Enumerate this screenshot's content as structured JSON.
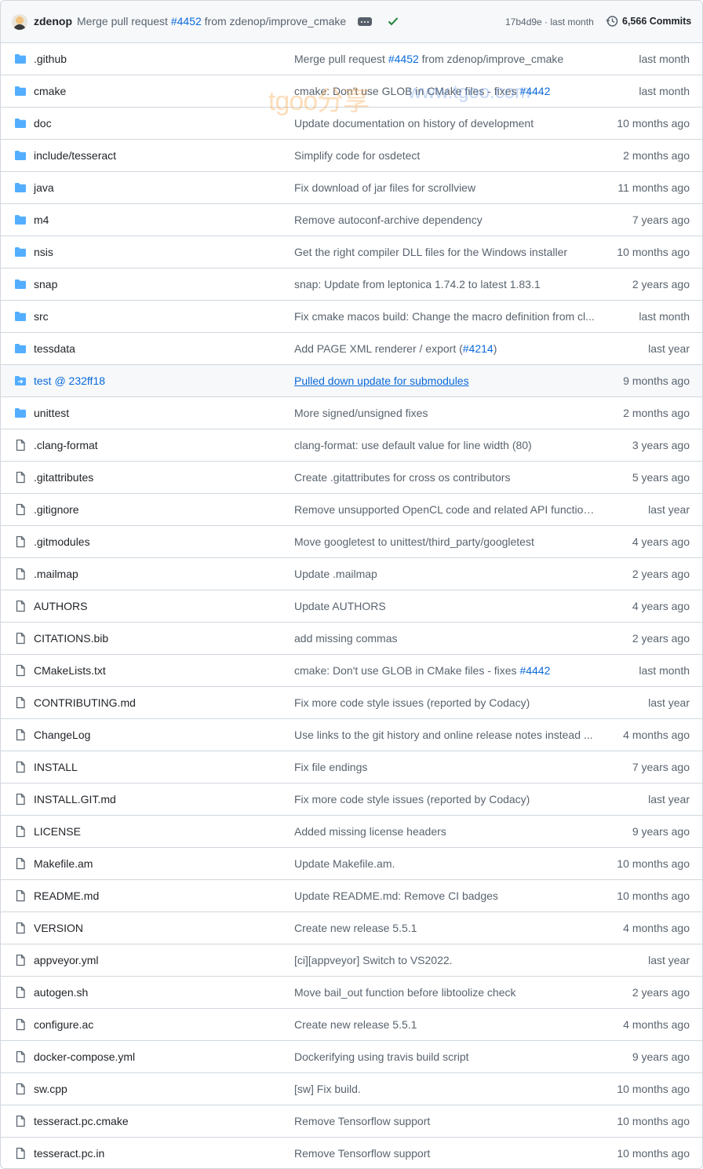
{
  "latest_commit": {
    "author": "zdenop",
    "message_prefix": "Merge pull request ",
    "pr_link": "#4452",
    "message_suffix": " from zdenop/improve_cmake",
    "sha": "17b4d9e · last month",
    "commits_count": "6,566 Commits",
    "status_color": "#1a7f37"
  },
  "watermark": {
    "text_a": "tgoo分享",
    "text_b": "www.tgoo.com"
  },
  "colors": {
    "folder": "#54aeff",
    "file_icon": "#59636e",
    "link": "#0969da"
  },
  "rows": [
    {
      "type": "folder",
      "name": ".github",
      "msg_before": "Merge pull request ",
      "msg_link": "#4452",
      "msg_after": " from zdenop/improve_cmake",
      "age": "last month"
    },
    {
      "type": "folder",
      "name": "cmake",
      "msg_before": "cmake: Don't use GLOB in CMake files - fixes ",
      "msg_link": "#4442",
      "msg_after": "",
      "age": "last month"
    },
    {
      "type": "folder",
      "name": "doc",
      "msg_before": "Update documentation on history of development",
      "msg_link": "",
      "msg_after": "",
      "age": "10 months ago"
    },
    {
      "type": "folder",
      "name": "include/tesseract",
      "msg_before": "Simplify code for osdetect",
      "msg_link": "",
      "msg_after": "",
      "age": "2 months ago"
    },
    {
      "type": "folder",
      "name": "java",
      "msg_before": "Fix download of jar files for scrollview",
      "msg_link": "",
      "msg_after": "",
      "age": "11 months ago"
    },
    {
      "type": "folder",
      "name": "m4",
      "msg_before": "Remove autoconf-archive dependency",
      "msg_link": "",
      "msg_after": "",
      "age": "7 years ago"
    },
    {
      "type": "folder",
      "name": "nsis",
      "msg_before": "Get the right compiler DLL files for the Windows installer",
      "msg_link": "",
      "msg_after": "",
      "age": "10 months ago"
    },
    {
      "type": "folder",
      "name": "snap",
      "msg_before": "snap: Update from leptonica 1.74.2 to latest 1.83.1",
      "msg_link": "",
      "msg_after": "",
      "age": "2 years ago"
    },
    {
      "type": "folder",
      "name": "src",
      "msg_before": "Fix cmake macos build: Change the macro definition from cl...",
      "msg_link": "",
      "msg_after": "",
      "age": "last month"
    },
    {
      "type": "folder",
      "name": "tessdata",
      "msg_before": "Add PAGE XML renderer / export (",
      "msg_link": "#4214",
      "msg_after": ")",
      "age": "last year"
    },
    {
      "type": "submodule",
      "name": "test @ 232ff18",
      "msg_before": "Pulled down update for submodules",
      "msg_link": "",
      "msg_after": "",
      "age": "9 months ago"
    },
    {
      "type": "folder",
      "name": "unittest",
      "msg_before": "More signed/unsigned fixes",
      "msg_link": "",
      "msg_after": "",
      "age": "2 months ago"
    },
    {
      "type": "file",
      "name": ".clang-format",
      "msg_before": "clang-format: use default value for line width (80)",
      "msg_link": "",
      "msg_after": "",
      "age": "3 years ago"
    },
    {
      "type": "file",
      "name": ".gitattributes",
      "msg_before": "Create .gitattributes for cross os contributors",
      "msg_link": "",
      "msg_after": "",
      "age": "5 years ago"
    },
    {
      "type": "file",
      "name": ".gitignore",
      "msg_before": "Remove unsupported OpenCL code and related API function...",
      "msg_link": "",
      "msg_after": "",
      "age": "last year"
    },
    {
      "type": "file",
      "name": ".gitmodules",
      "msg_before": "Move googletest to unittest/third_party/googletest",
      "msg_link": "",
      "msg_after": "",
      "age": "4 years ago"
    },
    {
      "type": "file",
      "name": ".mailmap",
      "msg_before": "Update .mailmap",
      "msg_link": "",
      "msg_after": "",
      "age": "2 years ago"
    },
    {
      "type": "file",
      "name": "AUTHORS",
      "msg_before": "Update AUTHORS",
      "msg_link": "",
      "msg_after": "",
      "age": "4 years ago"
    },
    {
      "type": "file",
      "name": "CITATIONS.bib",
      "msg_before": "add missing commas",
      "msg_link": "",
      "msg_after": "",
      "age": "2 years ago"
    },
    {
      "type": "file",
      "name": "CMakeLists.txt",
      "msg_before": "cmake: Don't use GLOB in CMake files - fixes ",
      "msg_link": "#4442",
      "msg_after": "",
      "age": "last month"
    },
    {
      "type": "file",
      "name": "CONTRIBUTING.md",
      "msg_before": "Fix more code style issues (reported by Codacy)",
      "msg_link": "",
      "msg_after": "",
      "age": "last year"
    },
    {
      "type": "file",
      "name": "ChangeLog",
      "msg_before": "Use links to the git history and online release notes instead ...",
      "msg_link": "",
      "msg_after": "",
      "age": "4 months ago"
    },
    {
      "type": "file",
      "name": "INSTALL",
      "msg_before": "Fix file endings",
      "msg_link": "",
      "msg_after": "",
      "age": "7 years ago"
    },
    {
      "type": "file",
      "name": "INSTALL.GIT.md",
      "msg_before": "Fix more code style issues (reported by Codacy)",
      "msg_link": "",
      "msg_after": "",
      "age": "last year"
    },
    {
      "type": "file",
      "name": "LICENSE",
      "msg_before": "Added missing license headers",
      "msg_link": "",
      "msg_after": "",
      "age": "9 years ago"
    },
    {
      "type": "file",
      "name": "Makefile.am",
      "msg_before": "Update Makefile.am.",
      "msg_link": "",
      "msg_after": "",
      "age": "10 months ago"
    },
    {
      "type": "file",
      "name": "README.md",
      "msg_before": "Update README.md: Remove CI badges",
      "msg_link": "",
      "msg_after": "",
      "age": "10 months ago"
    },
    {
      "type": "file",
      "name": "VERSION",
      "msg_before": "Create new release 5.5.1",
      "msg_link": "",
      "msg_after": "",
      "age": "4 months ago"
    },
    {
      "type": "file",
      "name": "appveyor.yml",
      "msg_before": "[ci][appveyor] Switch to VS2022.",
      "msg_link": "",
      "msg_after": "",
      "age": "last year"
    },
    {
      "type": "file",
      "name": "autogen.sh",
      "msg_before": "Move bail_out function before libtoolize check",
      "msg_link": "",
      "msg_after": "",
      "age": "2 years ago"
    },
    {
      "type": "file",
      "name": "configure.ac",
      "msg_before": "Create new release 5.5.1",
      "msg_link": "",
      "msg_after": "",
      "age": "4 months ago"
    },
    {
      "type": "file",
      "name": "docker-compose.yml",
      "msg_before": "Dockerifying using travis build script",
      "msg_link": "",
      "msg_after": "",
      "age": "9 years ago"
    },
    {
      "type": "file",
      "name": "sw.cpp",
      "msg_before": "[sw] Fix build.",
      "msg_link": "",
      "msg_after": "",
      "age": "10 months ago"
    },
    {
      "type": "file",
      "name": "tesseract.pc.cmake",
      "msg_before": "Remove Tensorflow support",
      "msg_link": "",
      "msg_after": "",
      "age": "10 months ago"
    },
    {
      "type": "file",
      "name": "tesseract.pc.in",
      "msg_before": "Remove Tensorflow support",
      "msg_link": "",
      "msg_after": "",
      "age": "10 months ago"
    }
  ]
}
